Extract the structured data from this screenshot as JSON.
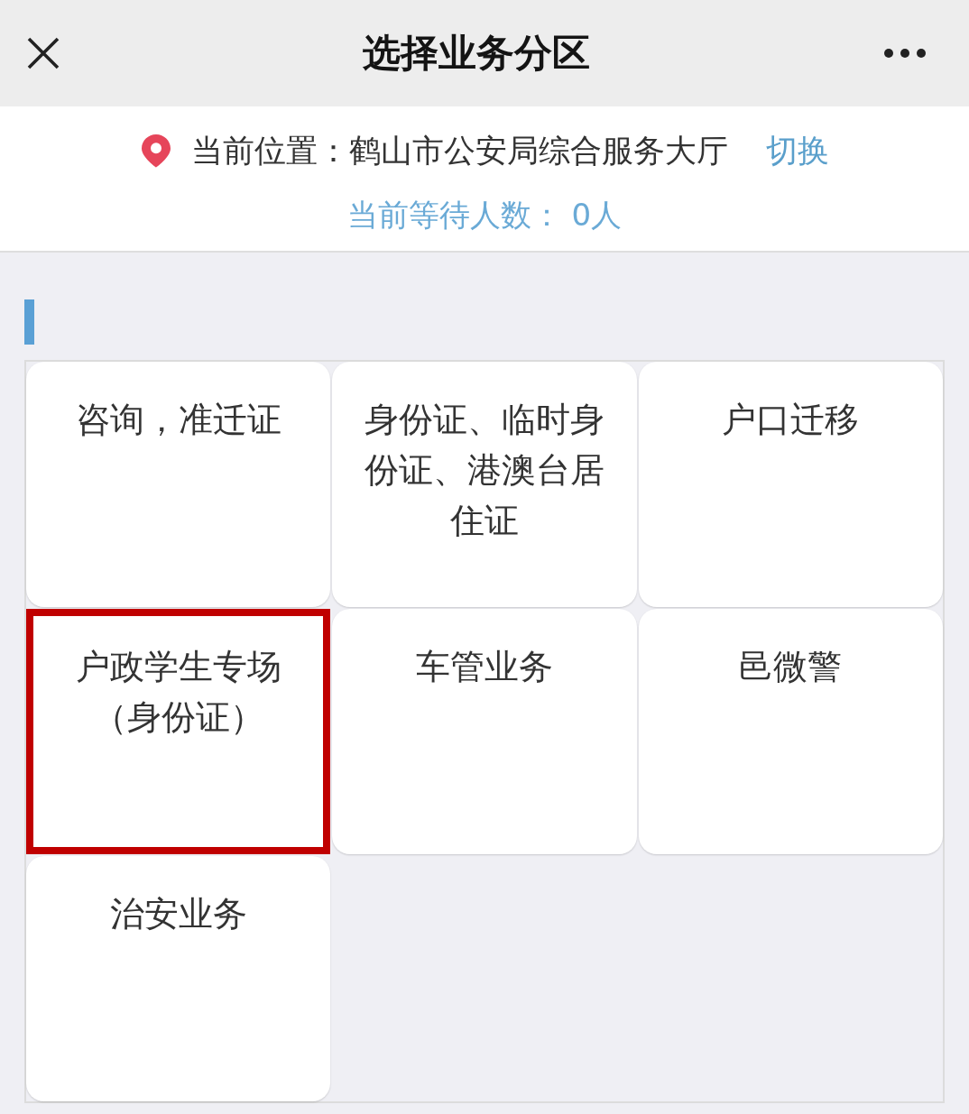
{
  "header": {
    "title": "选择业务分区"
  },
  "location": {
    "label": "当前位置：鹤山市公安局综合服务大厅",
    "switch_link": "切换",
    "waiting": "当前等待人数： 0人"
  },
  "zones": [
    {
      "label": "咨询，准迁证",
      "highlighted": false
    },
    {
      "label": "身份证、临时身份证、港澳台居住证",
      "highlighted": false
    },
    {
      "label": "户口迁移",
      "highlighted": false
    },
    {
      "label": "户政学生专场（身份证）",
      "highlighted": true
    },
    {
      "label": "车管业务",
      "highlighted": false
    },
    {
      "label": "邑微警",
      "highlighted": false
    },
    {
      "label": "治安业务",
      "highlighted": false
    }
  ]
}
